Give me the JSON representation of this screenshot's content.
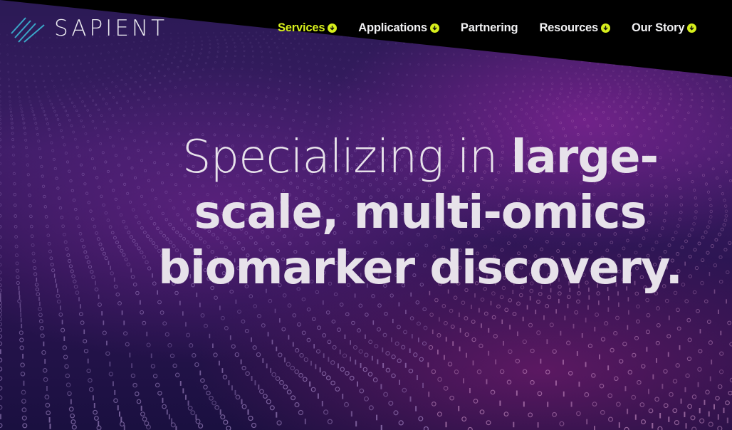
{
  "brand": {
    "name": "SAPIENT",
    "logo_icon": "diagonal-lines-logo-icon"
  },
  "nav": {
    "items": [
      {
        "label": "Services",
        "has_dropdown": true,
        "active": true
      },
      {
        "label": "Applications",
        "has_dropdown": true,
        "active": false
      },
      {
        "label": "Partnering",
        "has_dropdown": false,
        "active": false
      },
      {
        "label": "Resources",
        "has_dropdown": true,
        "active": false
      },
      {
        "label": "Our Story",
        "has_dropdown": true,
        "active": false
      }
    ],
    "dropdown_icon": "chevron-down-circle-icon"
  },
  "hero": {
    "line1_light": "Specializing in ",
    "line1_bold": "large-",
    "line2_bold": "scale, multi-omics",
    "line3_bold": "biomarker discovery."
  },
  "colors": {
    "accent": "#d7ef1c",
    "header_band": "#000000",
    "text": "#e7e2ea",
    "background_purple": "#3a1c64"
  }
}
